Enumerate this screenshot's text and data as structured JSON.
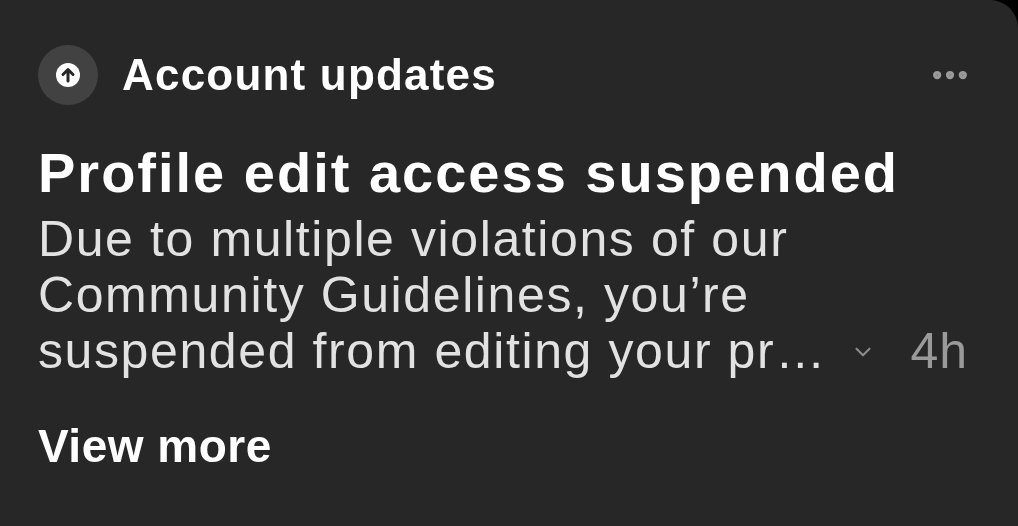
{
  "notification": {
    "category": "Account updates",
    "title": "Profile edit access suspended",
    "body": "Due to multiple violations of our Community Guidelines, you’re suspended from editing your pr…",
    "expanded": false,
    "time": "4h",
    "action": "View more"
  }
}
